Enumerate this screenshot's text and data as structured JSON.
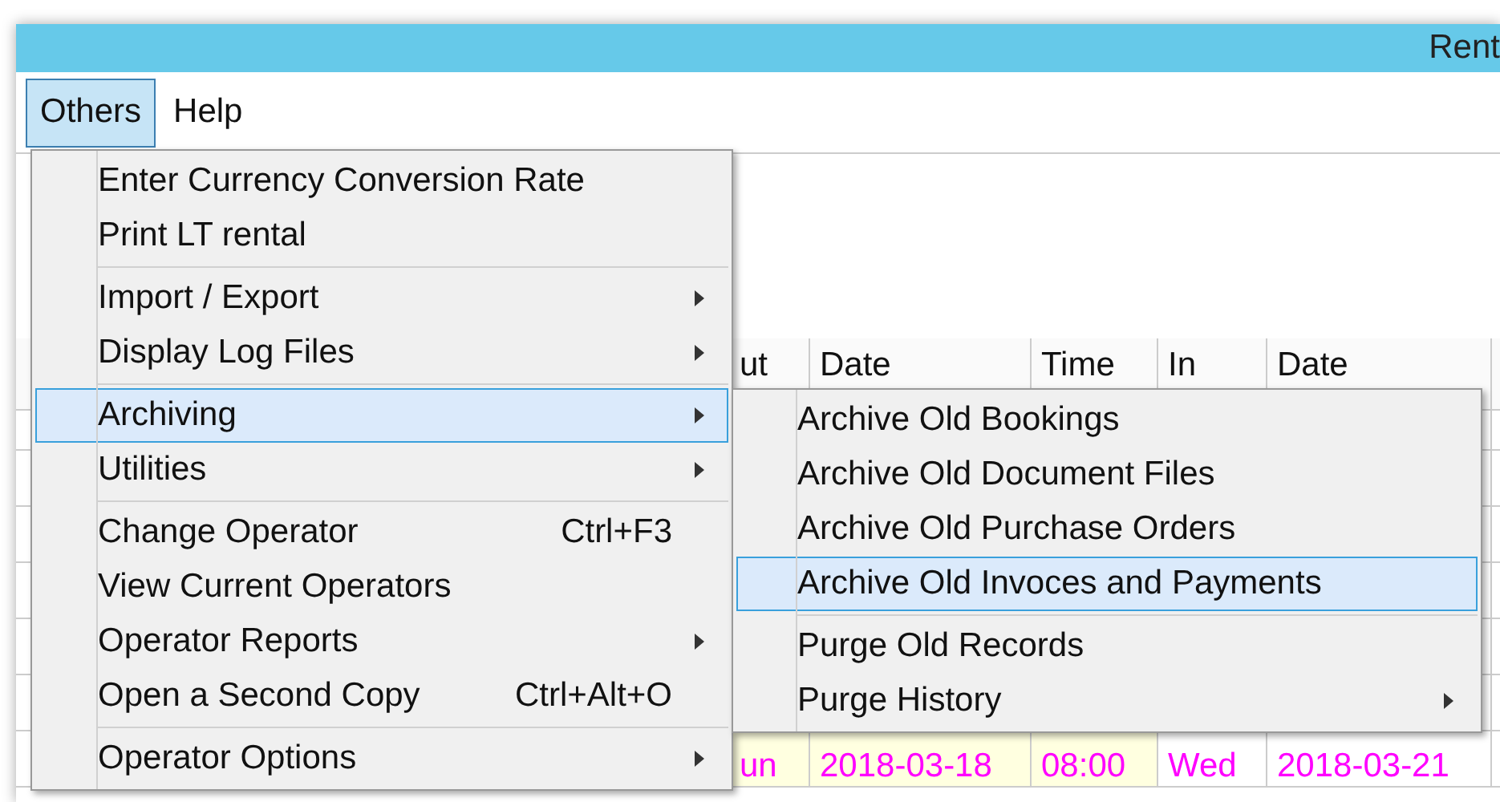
{
  "window": {
    "title": "Rent"
  },
  "menu_bar": [
    {
      "label": "Others",
      "selected": true
    },
    {
      "label": "Help",
      "selected": false
    }
  ],
  "table": {
    "columns": [
      "ut",
      "Date",
      "Time",
      "In",
      "Date"
    ],
    "rows": [
      {
        "cells": [
          "un",
          "2018-03-18",
          "08:00",
          "Wed",
          "2018-03-21"
        ]
      }
    ]
  },
  "others_menu": {
    "items": [
      {
        "kind": "item",
        "label": "Enter Currency Conversion Rate",
        "has_submenu": false,
        "selected": false
      },
      {
        "kind": "item",
        "label": "Print LT rental",
        "has_submenu": false,
        "selected": false
      },
      {
        "kind": "separator"
      },
      {
        "kind": "item",
        "label": "Import / Export",
        "has_submenu": true,
        "selected": false
      },
      {
        "kind": "item",
        "label": "Display Log Files",
        "has_submenu": true,
        "selected": false
      },
      {
        "kind": "separator"
      },
      {
        "kind": "item",
        "label": "Archiving",
        "has_submenu": true,
        "selected": true
      },
      {
        "kind": "item",
        "label": "Utilities",
        "has_submenu": true,
        "selected": false
      },
      {
        "kind": "separator"
      },
      {
        "kind": "item",
        "label": "Change Operator",
        "shortcut": "Ctrl+F3",
        "has_submenu": false,
        "selected": false
      },
      {
        "kind": "item",
        "label": "View Current Operators",
        "has_submenu": false,
        "selected": false
      },
      {
        "kind": "item",
        "label": "Operator Reports",
        "has_submenu": true,
        "selected": false
      },
      {
        "kind": "item",
        "label": "Open a Second Copy",
        "shortcut": "Ctrl+Alt+O",
        "has_submenu": false,
        "selected": false
      },
      {
        "kind": "separator"
      },
      {
        "kind": "item",
        "label": "Operator Options",
        "has_submenu": true,
        "selected": false
      }
    ]
  },
  "archiving_submenu": {
    "items": [
      {
        "kind": "item",
        "label": "Archive Old Bookings",
        "has_submenu": false,
        "selected": false
      },
      {
        "kind": "item",
        "label": "Archive Old Document Files",
        "has_submenu": false,
        "selected": false
      },
      {
        "kind": "item",
        "label": "Archive Old Purchase Orders",
        "has_submenu": false,
        "selected": false
      },
      {
        "kind": "item",
        "label": "Archive Old Invoces and Payments",
        "has_submenu": false,
        "selected": true
      },
      {
        "kind": "separator"
      },
      {
        "kind": "item",
        "label": "Purge Old Records",
        "has_submenu": false,
        "selected": false
      },
      {
        "kind": "item",
        "label": "Purge History",
        "has_submenu": true,
        "selected": false
      }
    ]
  }
}
